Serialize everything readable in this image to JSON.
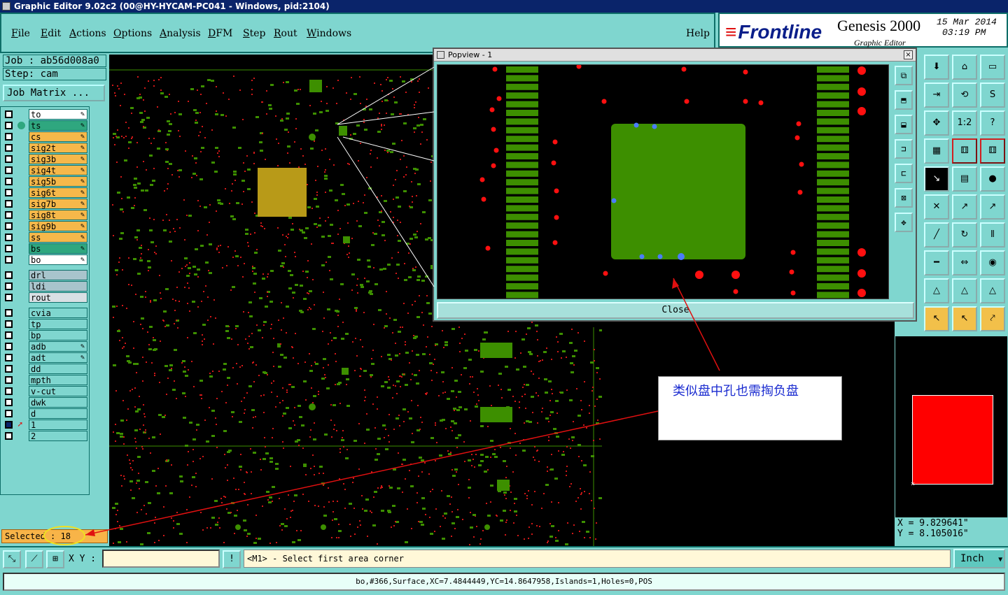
{
  "window": {
    "title": "Graphic Editor 9.02c2 (00@HY-HYCAM-PC041 - Windows, pid:2104)"
  },
  "menus": [
    "File",
    "Edit",
    "Actions",
    "Options",
    "Analysis",
    "DFM",
    "Step",
    "Rout",
    "Windows"
  ],
  "help_label": "Help",
  "brand": {
    "logo": "Frontline",
    "product": "Genesis 2000",
    "subtitle": "Graphic Editor",
    "date": "15 Mar 2014",
    "time": "03:19 PM"
  },
  "job": {
    "job_label": "Job : ab56d008a0",
    "step_label": "Step: cam",
    "matrix_button": "Job Matrix ..."
  },
  "layers": {
    "board": [
      {
        "name": "to",
        "color": "#ffffff",
        "edit": true
      },
      {
        "name": "ts",
        "color": "#2fa77f",
        "edit": true,
        "active": true
      },
      {
        "name": "cs",
        "color": "#f6b84a",
        "edit": true
      },
      {
        "name": "sig2t",
        "color": "#f6b84a",
        "edit": true
      },
      {
        "name": "sig3b",
        "color": "#f6b84a",
        "edit": true
      },
      {
        "name": "sig4t",
        "color": "#f6b84a",
        "edit": true
      },
      {
        "name": "sig5b",
        "color": "#f6b84a",
        "edit": true
      },
      {
        "name": "sig6t",
        "color": "#f6b84a",
        "edit": true
      },
      {
        "name": "sig7b",
        "color": "#f6b84a",
        "edit": true
      },
      {
        "name": "sig8t",
        "color": "#f6b84a",
        "edit": true
      },
      {
        "name": "sig9b",
        "color": "#f6b84a",
        "edit": true
      },
      {
        "name": "ss",
        "color": "#f6b84a",
        "edit": true
      },
      {
        "name": "bs",
        "color": "#2fa77f",
        "edit": true
      },
      {
        "name": "bo",
        "color": "#ffffff",
        "edit": true
      }
    ],
    "drill": [
      {
        "name": "drl",
        "color": "#a8c4cc"
      },
      {
        "name": "ldi",
        "color": "#a8c4cc"
      },
      {
        "name": "rout",
        "color": "#d8e0e4"
      }
    ],
    "misc": [
      {
        "name": "cvia",
        "color": "#7fd6cf"
      },
      {
        "name": "tp",
        "color": "#7fd6cf"
      },
      {
        "name": "bp",
        "color": "#7fd6cf"
      },
      {
        "name": "adb",
        "color": "#7fd6cf",
        "edit": true
      },
      {
        "name": "adt",
        "color": "#7fd6cf",
        "edit": true
      },
      {
        "name": "dd",
        "color": "#7fd6cf"
      },
      {
        "name": "mpth",
        "color": "#7fd6cf"
      },
      {
        "name": "v-cut",
        "color": "#7fd6cf"
      },
      {
        "name": "dwk",
        "color": "#7fd6cf"
      },
      {
        "name": "d",
        "color": "#7fd6cf"
      },
      {
        "name": "1",
        "color": "#7fd6cf",
        "selected": true
      },
      {
        "name": "2",
        "color": "#7fd6cf"
      }
    ]
  },
  "selected": {
    "label": "Selected : 18"
  },
  "popview": {
    "title": "Popview - 1",
    "close_button": "Close",
    "close_x": "×"
  },
  "tools": {
    "pop_side": [
      "⧉",
      "⬒",
      "⬓",
      "⊐",
      "⊏",
      "⊠",
      "✥"
    ],
    "palette": [
      [
        "⬇",
        "⌂",
        "▭"
      ],
      [
        "⇥",
        "⟲",
        "S"
      ],
      [
        "✥",
        "1:2",
        "?"
      ],
      [
        "▦",
        "⚅",
        "⚅"
      ],
      [
        "↘",
        "▤",
        "●"
      ],
      [
        "✕",
        "↗",
        "↗"
      ],
      [
        "╱",
        "↻",
        "⫴"
      ],
      [
        "━",
        "⇔",
        "◉"
      ],
      [
        "△",
        "△",
        "△"
      ],
      [
        "↖",
        "↖",
        "⤤"
      ]
    ]
  },
  "coords": {
    "x": "X = 9.829641\"",
    "y": "Y = 8.105016\""
  },
  "bottom": {
    "xy_label": "X Y :",
    "xy_value": "",
    "alert": "!",
    "prompt": "<M1> - Select first area corner",
    "unit": "Inch",
    "buttons": [
      "⤡",
      "⟋",
      "⊞"
    ]
  },
  "status": {
    "text": "bo,#366,Surface,XC=7.4844449,YC=14.8647958,Islands=1,Holes=0,POS"
  },
  "annotation": {
    "text": "类似盘中孔也需掏负盘"
  },
  "colors": {
    "accent_red": "#e01010",
    "pcb_green": "#3d8f00",
    "cyan_panel": "#7fd6cf",
    "annotation_blue": "#1a2bd0"
  }
}
